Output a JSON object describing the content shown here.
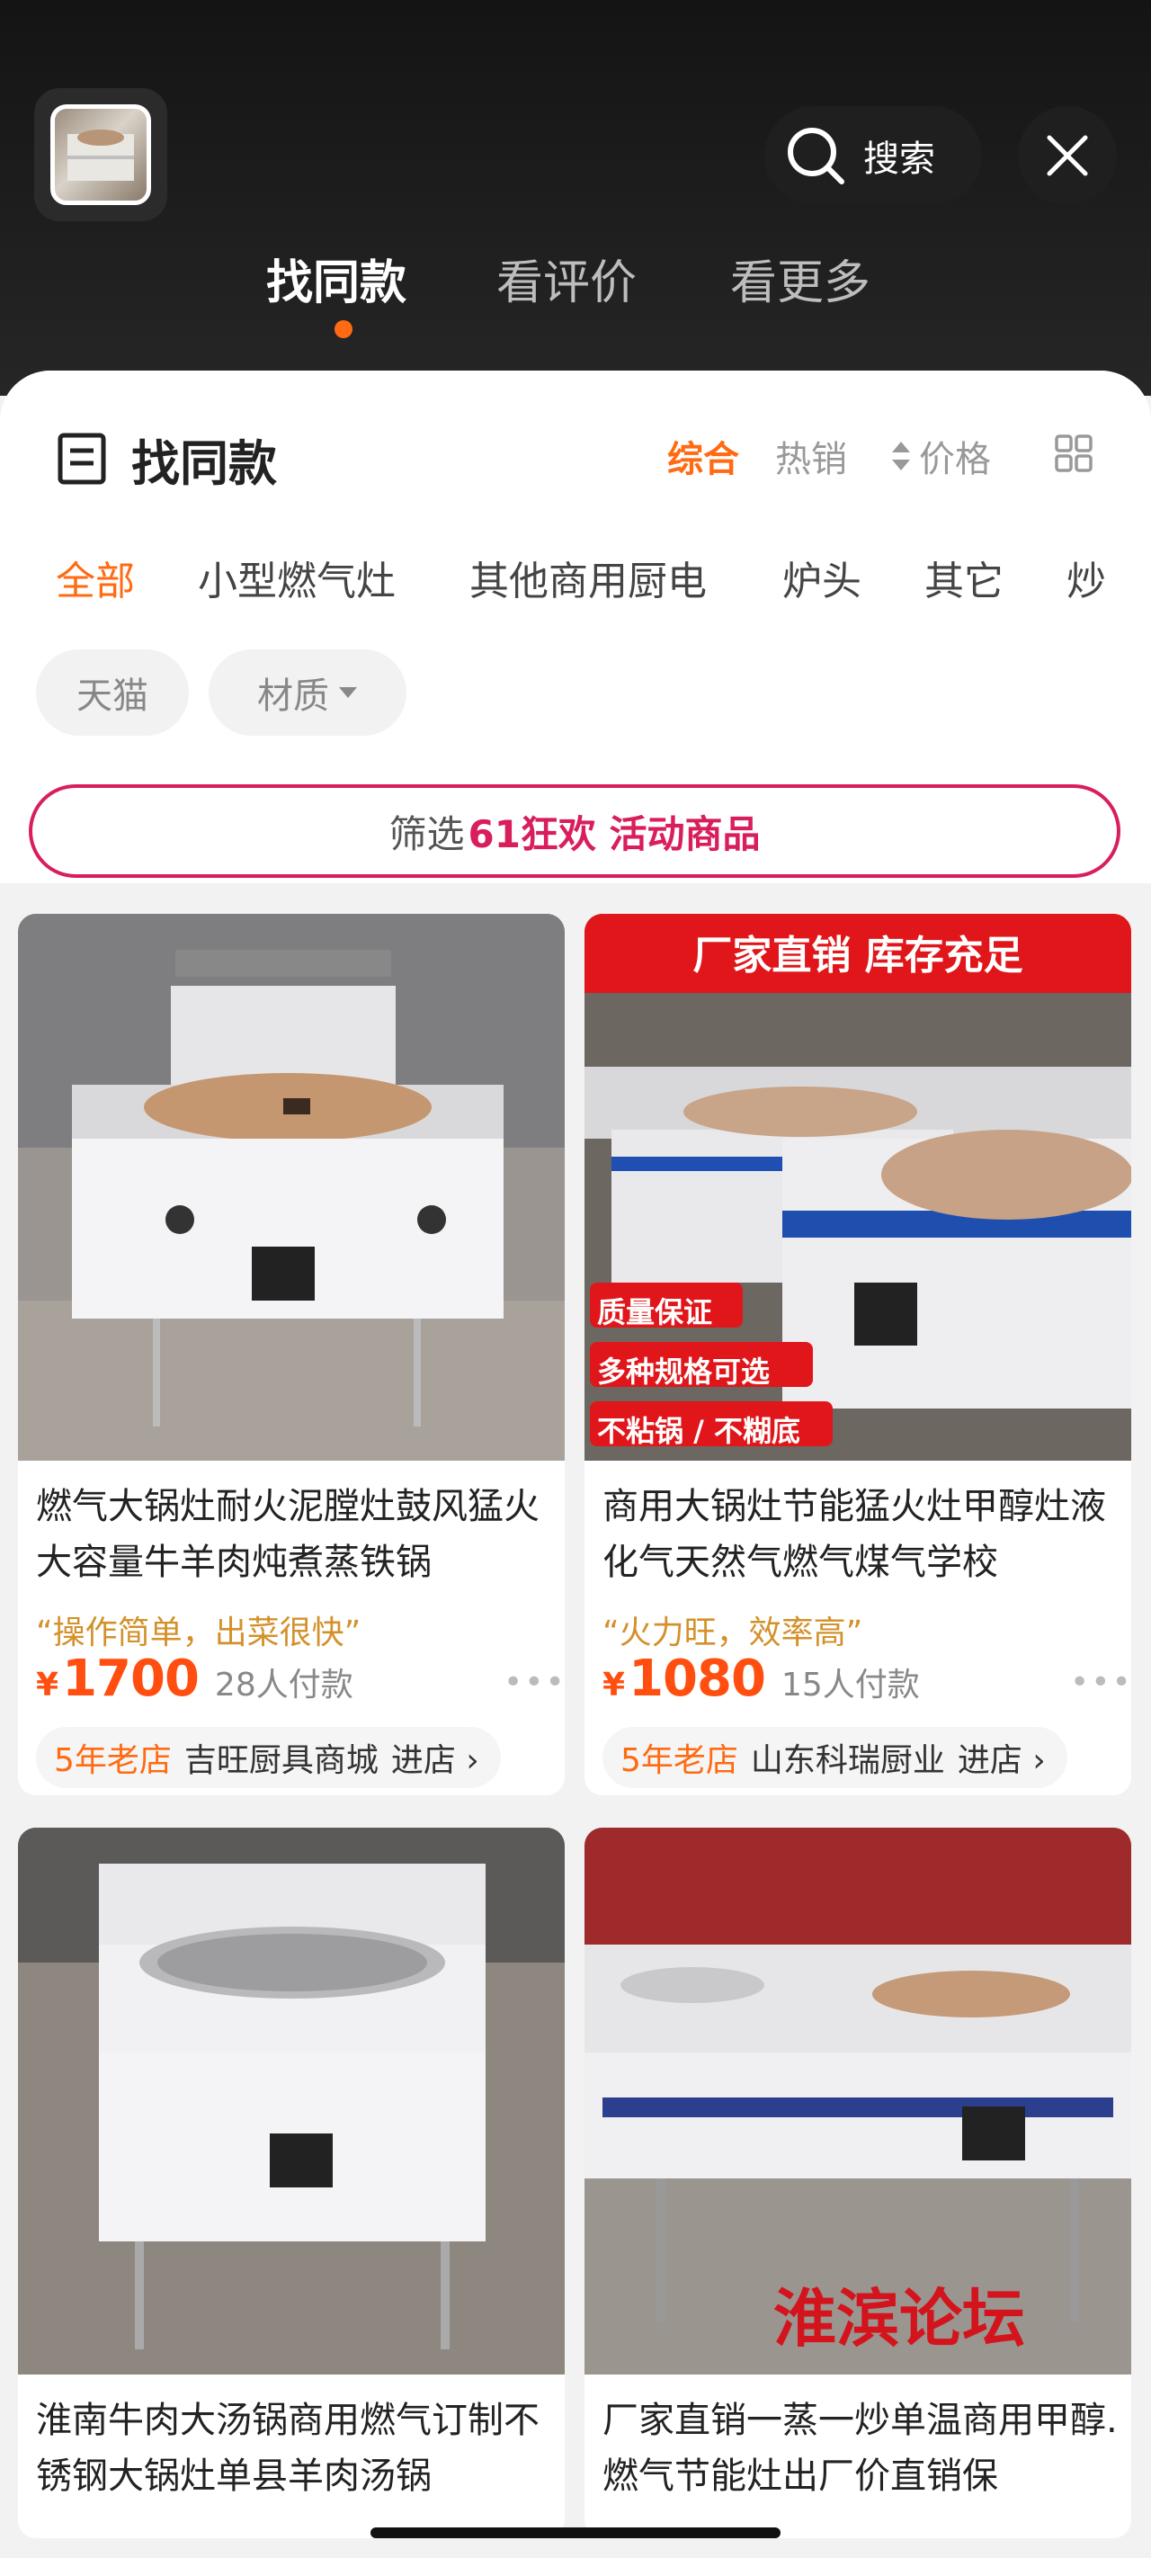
{
  "header": {
    "search_label": "搜索",
    "tabs": [
      {
        "label": "找同款",
        "active": true
      },
      {
        "label": "看评价",
        "active": false
      },
      {
        "label": "看更多",
        "active": false
      }
    ]
  },
  "panel": {
    "title": "找同款",
    "sort": {
      "comprehensive": "综合",
      "hot": "热销",
      "price": "价格"
    },
    "categories": [
      "全部",
      "小型燃气灶",
      "其他商用厨电",
      "炉头",
      "其它",
      "炒"
    ],
    "chips": {
      "tmall": "天猫",
      "material": "材质"
    },
    "promo": {
      "prefix": "筛选",
      "highlight": "61狂欢 活动商品"
    }
  },
  "products": [
    {
      "title": "燃气大锅灶耐火泥膛灶鼓风猛火大容量牛羊肉炖煮蒸铁锅",
      "slogan": "“操作简单，出菜很快”",
      "currency": "¥",
      "price": "1700",
      "paid": "28人付款",
      "shop_age": "5年老店",
      "shop_name": "吉旺厨具商城",
      "enter": "进店 ›"
    },
    {
      "title": "商用大锅灶节能猛火灶甲醇灶液化气天然气燃气煤气学校",
      "slogan": "“火力旺，效率高”",
      "currency": "¥",
      "price": "1080",
      "paid": "15人付款",
      "shop_age": "5年老店",
      "shop_name": "山东科瑞厨业",
      "enter": "进店 ›",
      "banner": "厂家直销 库存充足",
      "tags": [
        "质量保证",
        "多种规格可选",
        "不粘锅 / 不糊底"
      ]
    },
    {
      "title": "淮南牛肉大汤锅商用燃气订制不锈钢大锅灶单县羊肉汤锅"
    },
    {
      "title": "厂家直销一蒸一炒单温商用甲醇.燃气节能灶出厂价直销保",
      "watermark": "淮滨论坛"
    }
  ],
  "colors": {
    "accent": "#ff6a12",
    "price": "#ff4e0f",
    "promo": "#d81e5b",
    "slogan": "#d3912b"
  }
}
